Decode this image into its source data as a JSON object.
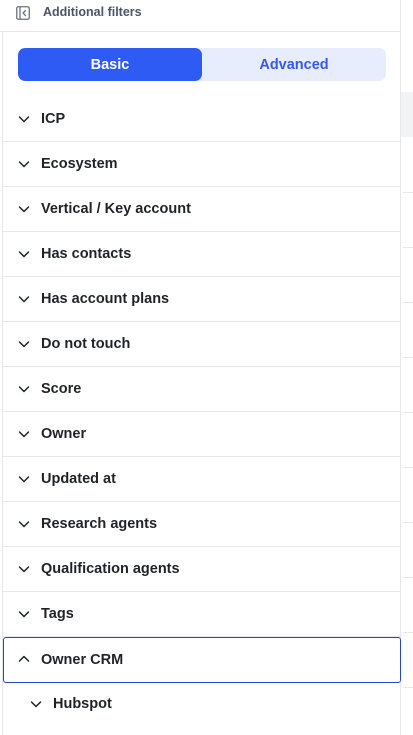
{
  "header": {
    "title": "Additional filters",
    "collapse_icon": "panel-collapse-icon"
  },
  "toggle": {
    "basic_label": "Basic",
    "advanced_label": "Advanced",
    "selected": "Basic",
    "active_color": "#2f5bf5",
    "inactive_bg": "#e8edfd"
  },
  "filters": [
    {
      "label": "ICP",
      "expanded": false
    },
    {
      "label": "Ecosystem",
      "expanded": false
    },
    {
      "label": "Vertical / Key account",
      "expanded": false
    },
    {
      "label": "Has contacts",
      "expanded": false
    },
    {
      "label": "Has account plans",
      "expanded": false
    },
    {
      "label": "Do not touch",
      "expanded": false
    },
    {
      "label": "Score",
      "expanded": false
    },
    {
      "label": "Owner",
      "expanded": false
    },
    {
      "label": "Updated at",
      "expanded": false
    },
    {
      "label": "Research agents",
      "expanded": false
    },
    {
      "label": "Qualification agents",
      "expanded": false
    },
    {
      "label": "Tags",
      "expanded": false
    },
    {
      "label": "Owner CRM",
      "expanded": true
    }
  ],
  "owner_crm_children": [
    {
      "label": "Hubspot",
      "expanded": false
    }
  ]
}
